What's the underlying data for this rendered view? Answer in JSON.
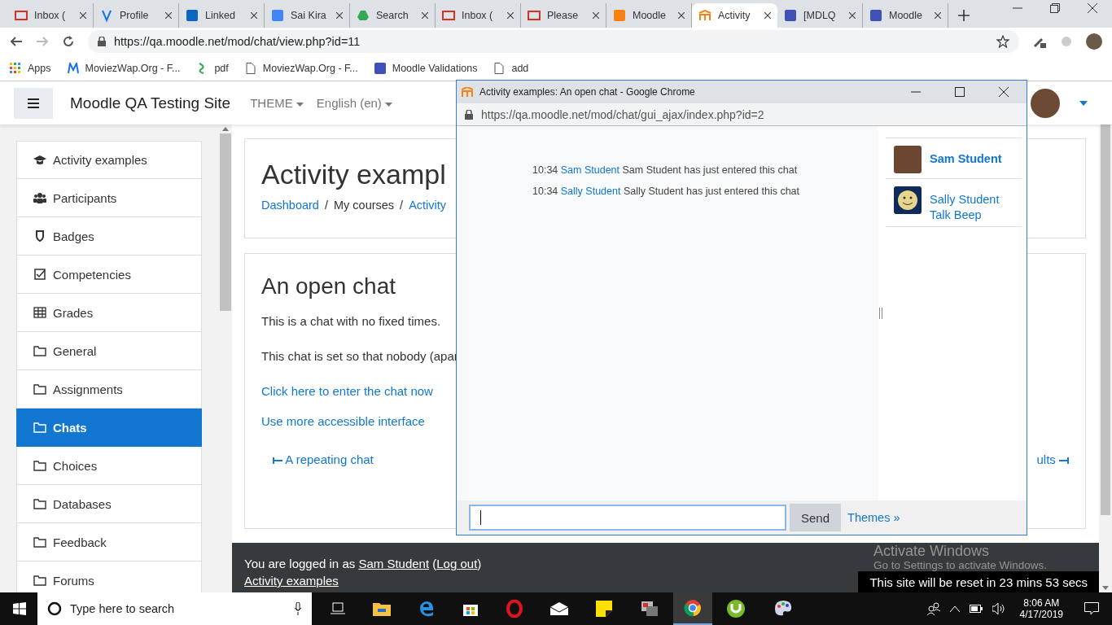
{
  "browser": {
    "tabs": [
      {
        "label": "Inbox (",
        "kind": "mail",
        "selected": false
      },
      {
        "label": "Profile",
        "kind": "profile",
        "selected": false
      },
      {
        "label": "Linked",
        "kind": "linkedin",
        "selected": false
      },
      {
        "label": "Sai Kira",
        "kind": "doc",
        "selected": false
      },
      {
        "label": "Search",
        "kind": "drive",
        "selected": false
      },
      {
        "label": "Inbox (",
        "kind": "mail",
        "selected": false
      },
      {
        "label": "Please",
        "kind": "mail",
        "selected": false
      },
      {
        "label": "Moodle",
        "kind": "moodle",
        "selected": false
      },
      {
        "label": "Activity",
        "kind": "moodle-cap",
        "selected": true
      },
      {
        "label": "[MDLQ",
        "kind": "moodle-blue",
        "selected": false
      },
      {
        "label": "Moodle",
        "kind": "moodle-blue",
        "selected": false
      }
    ],
    "address": "https://qa.moodle.net/mod/chat/view.php?id=11",
    "bookmarks": [
      {
        "label": "Apps",
        "kind": "apps"
      },
      {
        "label": "MoviezWap.Org - F...",
        "kind": "m"
      },
      {
        "label": "pdf",
        "kind": "leaf"
      },
      {
        "label": "MoviezWap.Org - F...",
        "kind": "page"
      },
      {
        "label": "Moodle Validations",
        "kind": "moodle-blue"
      },
      {
        "label": "add",
        "kind": "page"
      }
    ]
  },
  "site": {
    "title": "Moodle QA Testing Site",
    "menus": [
      "THEME",
      "English (en)"
    ]
  },
  "sidebar": {
    "items": [
      {
        "label": "Activity examples",
        "kind": "cap",
        "selected": false
      },
      {
        "label": "Participants",
        "kind": "users",
        "selected": false
      },
      {
        "label": "Badges",
        "kind": "shield",
        "selected": false
      },
      {
        "label": "Competencies",
        "kind": "check",
        "selected": false
      },
      {
        "label": "Grades",
        "kind": "table",
        "selected": false
      },
      {
        "label": "General",
        "kind": "folder",
        "selected": false
      },
      {
        "label": "Assignments",
        "kind": "folder",
        "selected": false
      },
      {
        "label": "Chats",
        "kind": "folder",
        "selected": true
      },
      {
        "label": "Choices",
        "kind": "folder",
        "selected": false
      },
      {
        "label": "Databases",
        "kind": "folder",
        "selected": false
      },
      {
        "label": "Feedback",
        "kind": "folder",
        "selected": false
      },
      {
        "label": "Forums",
        "kind": "folder",
        "selected": false
      }
    ]
  },
  "page": {
    "heading": "Activity exampl",
    "breadcrumb": [
      {
        "label": "Dashboard",
        "link": true
      },
      {
        "separator": "/",
        "label": "My courses",
        "link": false
      },
      {
        "separator": "/",
        "label": "Activity",
        "link": true
      }
    ],
    "activity": {
      "title": "An open chat",
      "paragraphs": [
        "This is a chat with no fixed times.",
        "This chat is set so that nobody (apar"
      ],
      "links": [
        "Click here to enter the chat now",
        "Use more accessible interface"
      ],
      "prev": "A repeating chat",
      "next": "ults"
    }
  },
  "footer": {
    "logged_in_prefix": "You are logged in as ",
    "user": "Sam Student",
    "logout_open": " (",
    "logout": "Log out",
    "logout_close": ")",
    "course": "Activity examples"
  },
  "reset_notice": "This site will be reset in 23 mins 53 secs",
  "os_overlay": {
    "title": "Activate Windows",
    "subtitle": "Go to Settings to activate Windows."
  },
  "popup": {
    "title": "Activity examples: An open chat - Google Chrome",
    "url": "https://qa.moodle.net/mod/chat/gui_ajax/index.php?id=2",
    "messages": [
      {
        "time": "10:34",
        "user": "Sam Student",
        "text": "Sam Student has just entered this chat"
      },
      {
        "time": "10:34",
        "user": "Sally Student",
        "text": "Sally Student has just entered this chat"
      }
    ],
    "users": [
      {
        "name": "Sam Student",
        "self": true,
        "kind": "photo"
      },
      {
        "name": "Sally Student",
        "self": false,
        "kind": "smiley",
        "beep": "Talk Beep"
      }
    ],
    "send": "Send",
    "themes": "Themes »"
  },
  "taskbar": {
    "search_placeholder": "Type here to search",
    "time": "8:06 AM",
    "date": "4/17/2019"
  }
}
